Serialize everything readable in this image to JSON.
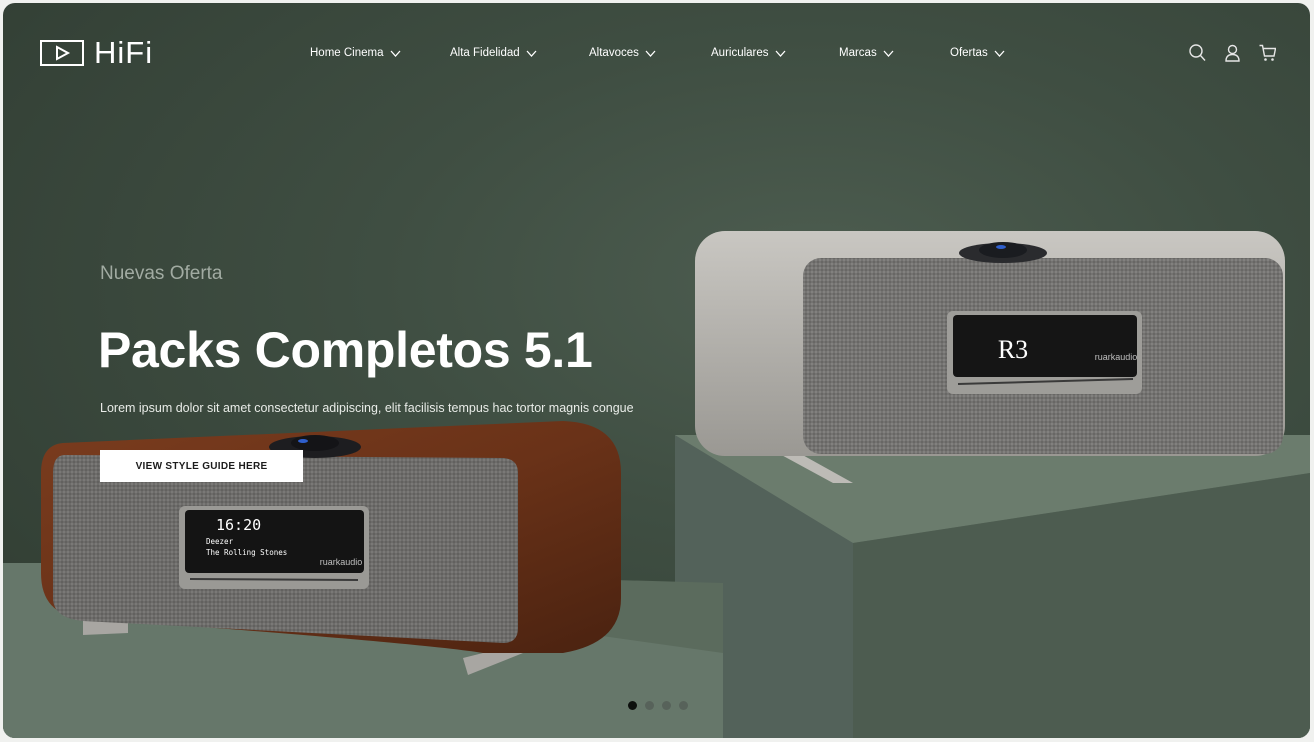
{
  "logo": {
    "text": "HiFi"
  },
  "nav": {
    "items": [
      {
        "label": "Home Cinema"
      },
      {
        "label": "Alta Fidelidad"
      },
      {
        "label": "Altavoces"
      },
      {
        "label": "Auriculares"
      },
      {
        "label": "Marcas"
      },
      {
        "label": "Ofertas"
      }
    ]
  },
  "header_icons": [
    "search-icon",
    "user-icon",
    "cart-icon"
  ],
  "hero": {
    "subtitle": "Nuevas Oferta",
    "title": "Packs Completos 5.1",
    "description": "Lorem ipsum dolor sit amet consectetur adipiscing, elit facilisis tempus hac tortor magnis congue",
    "cta_label": "VIEW STYLE GUIDE HERE"
  },
  "products": {
    "left": {
      "time": "16:20",
      "line1": "Deezer",
      "line2": "The Rolling Stones",
      "brand": "ruarkaudio"
    },
    "right": {
      "badge": "R3",
      "brand": "ruarkaudio"
    }
  },
  "carousel": {
    "slides": 4,
    "active": 1
  },
  "colors": {
    "background": "#3f4e42",
    "pedestal": "#5a6b5c",
    "accent_button": "#ffffff"
  }
}
